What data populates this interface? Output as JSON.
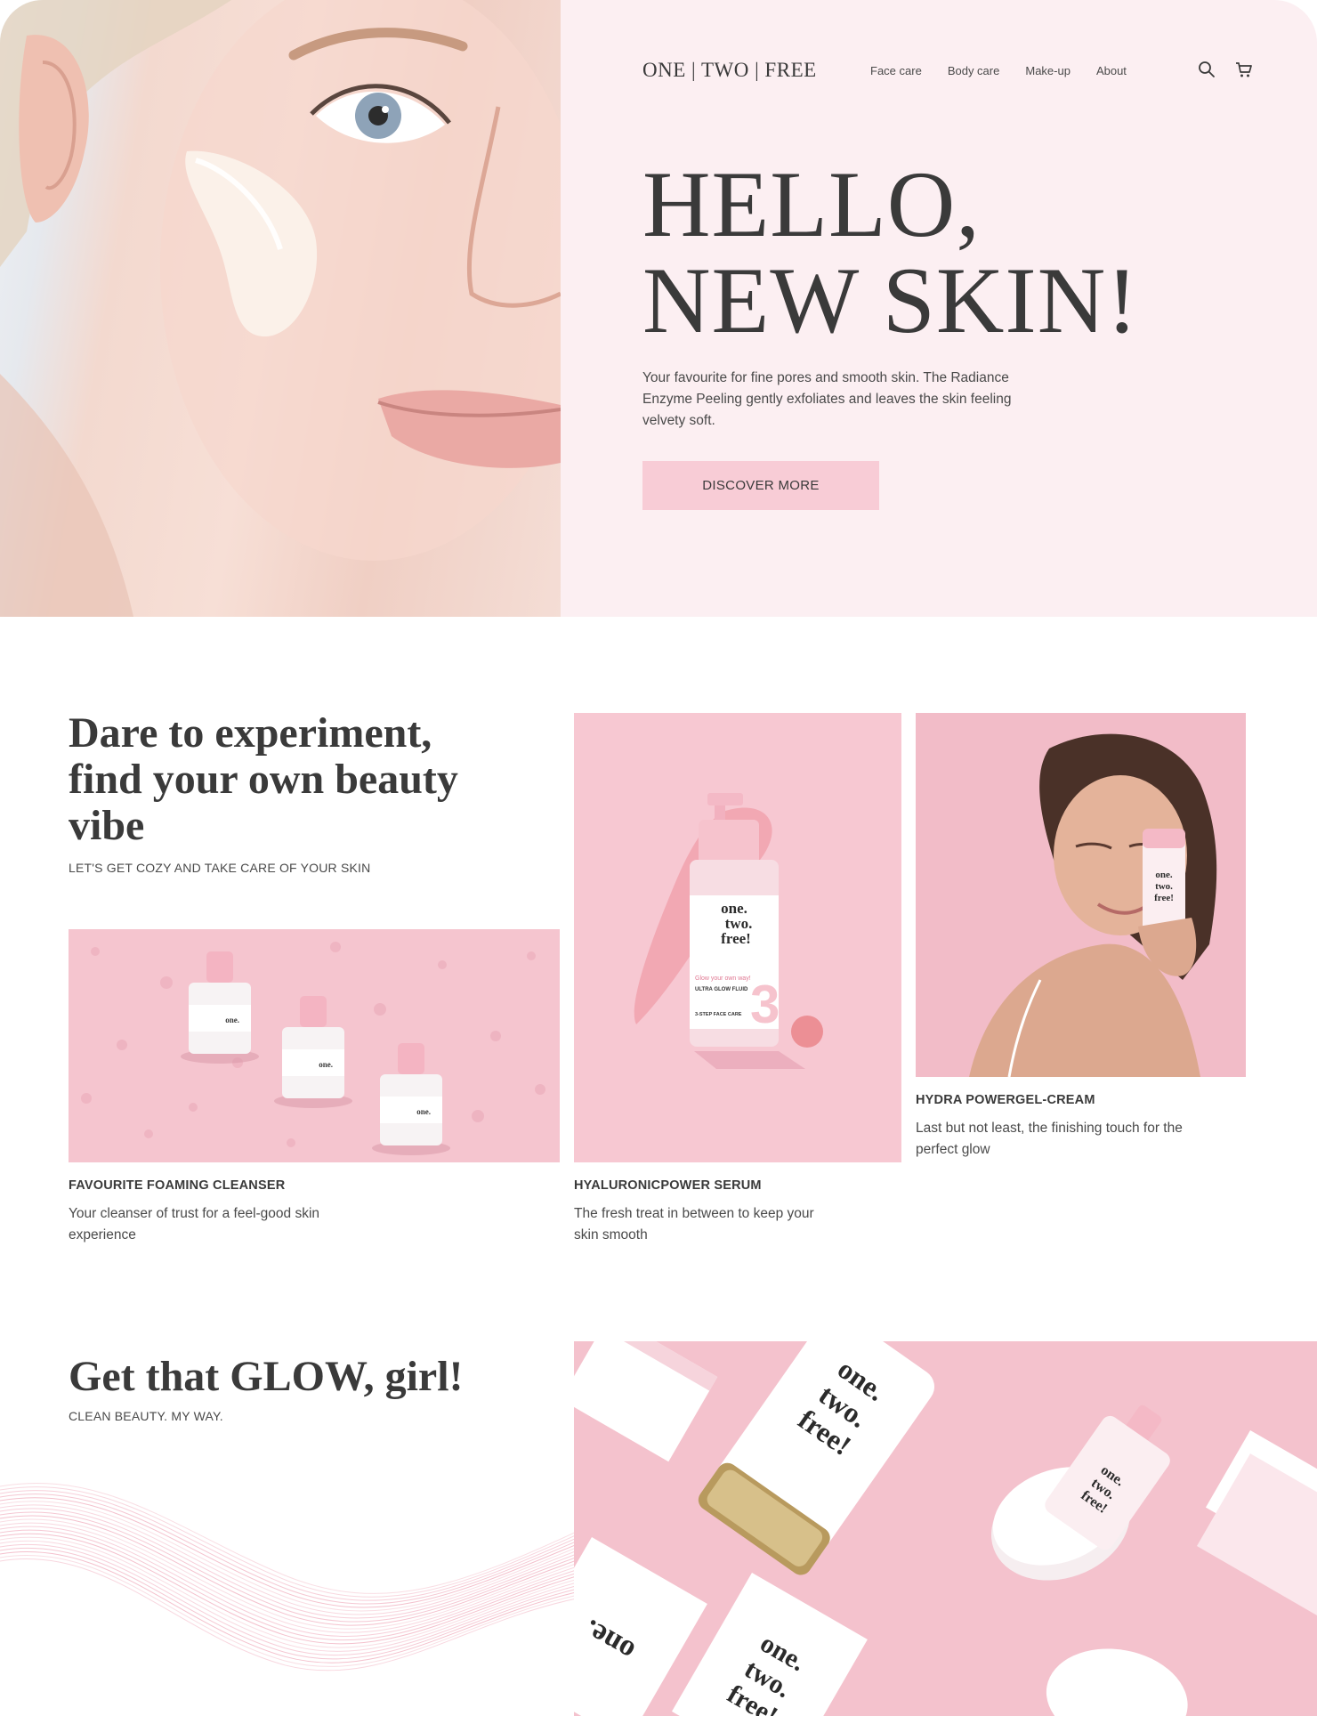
{
  "header": {
    "logo": "ONE | TWO | FREE",
    "nav": [
      "Face care",
      "Body care",
      "Make-up",
      "About"
    ],
    "icons": [
      "search-icon",
      "cart-icon"
    ]
  },
  "hero": {
    "title_line1": "HELLO,",
    "title_line2": "NEW SKIN!",
    "text": "Your favourite for fine pores and smooth skin. The Radiance Enzyme Peeling gently exfoliates and leaves the skin feeling velvety soft.",
    "button": "DISCOVER MORE"
  },
  "section2": {
    "title": "Dare to experiment, find your own beauty vibe",
    "subtitle": "LET'S GET COZY AND TAKE CARE OF YOUR SKIN",
    "cards": [
      {
        "title": "FAVOURITE FOAMING CLEANSER",
        "text": "Your cleanser of trust for a feel-good skin experience"
      },
      {
        "title": "HYALURONICPOWER SERUM",
        "text": "The fresh treat in between to keep your skin smooth"
      },
      {
        "title": "HYDRA POWERGEL-CREAM",
        "text": "Last but not least, the finishing touch for the perfect glow"
      }
    ],
    "product_label": {
      "brand": "one. two. free!",
      "tagline": "Glow your own way!",
      "name": "ULTRA GLOW FLUID",
      "step": "3-STEP FACE CARE",
      "number": "3"
    }
  },
  "section3": {
    "title": "Get that GLOW, girl!",
    "subtitle": "CLEAN BEAUTY. MY WAY."
  },
  "colors": {
    "hero_panel": "#fceff2",
    "button": "#f8ccd6",
    "product_pink": "#f6c6d0",
    "text": "#3a3a3a",
    "wave": "#f2b6c4"
  }
}
